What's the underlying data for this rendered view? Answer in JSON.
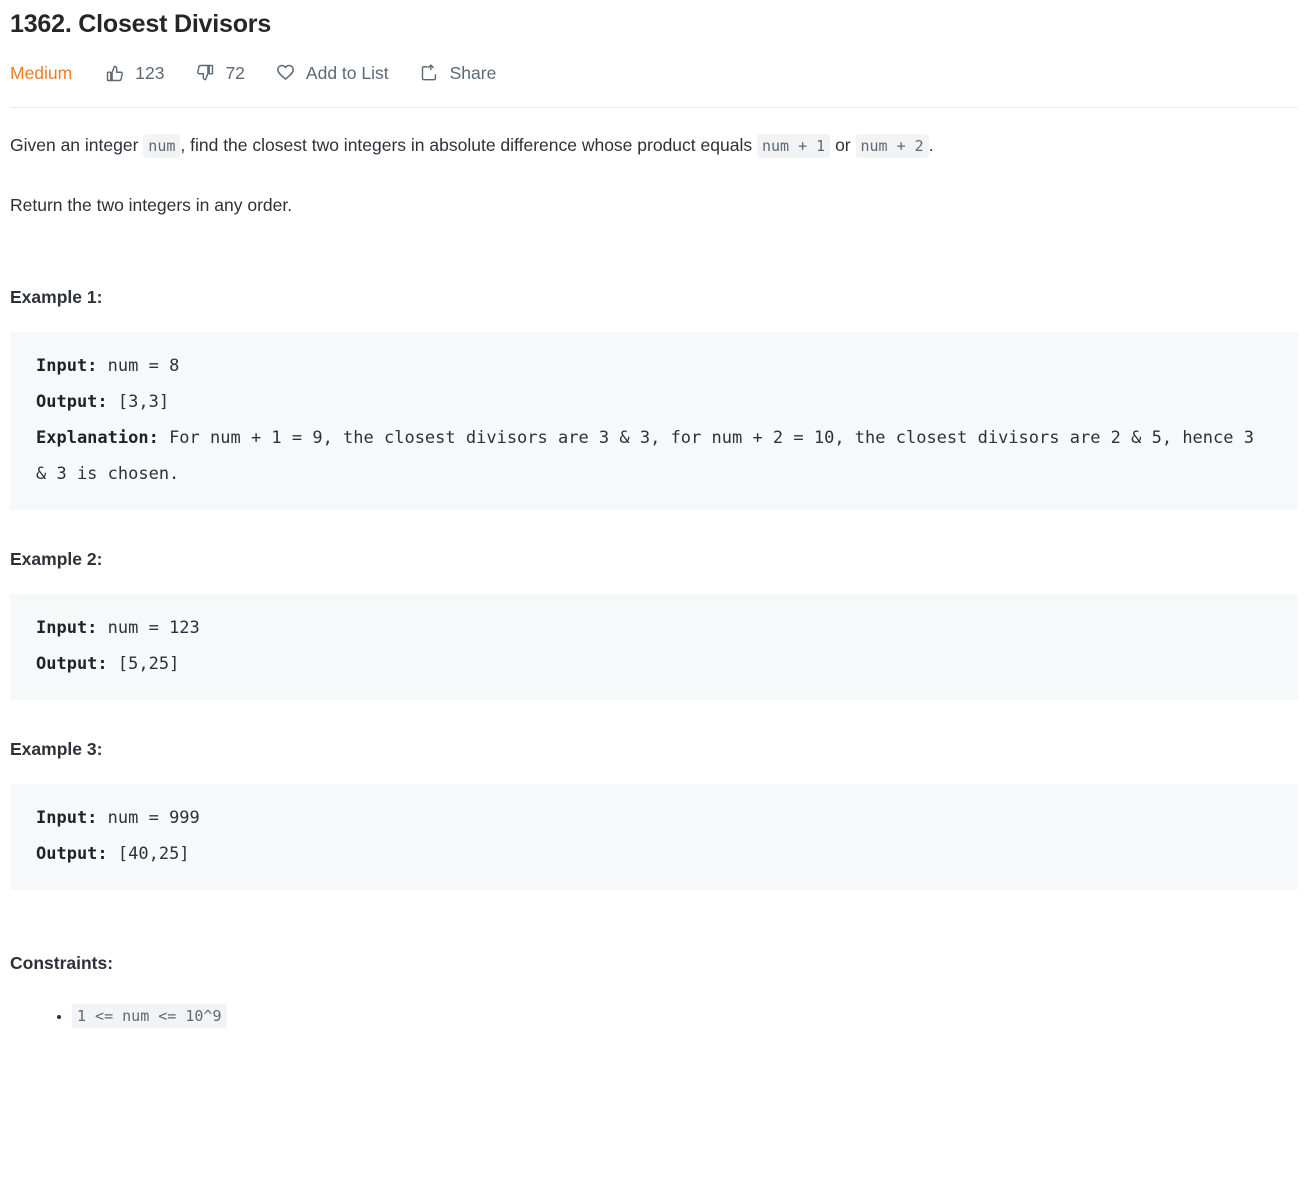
{
  "header": {
    "title": "1362. Closest Divisors",
    "difficulty": "Medium",
    "difficulty_color": "#ef7c22",
    "likes_icon": "thumbs-up-icon",
    "likes": "123",
    "dislikes_icon": "thumbs-down-icon",
    "dislikes": "72",
    "add_to_list_icon": "heart-icon",
    "add_to_list_label": "Add to List",
    "share_icon": "share-icon",
    "share_label": "Share"
  },
  "description": {
    "part1": "Given an integer",
    "code1": "num",
    "part2": ", find the closest two integers in absolute difference whose product equals",
    "code2": "num + 1",
    "part3": "or",
    "code3": "num + 2",
    "part4": ".",
    "return_line": "Return the two integers in any order."
  },
  "examples": [
    {
      "heading": "Example 1:",
      "input_label": "Input:",
      "input_value": " num = 8",
      "output_label": "Output:",
      "output_value": " [3,3]",
      "explanation_label": "Explanation:",
      "explanation_value": " For num + 1 = 9, the closest divisors are 3 & 3, for num + 2 = 10, the closest divisors are 2 & 5, hence 3 & 3 is chosen."
    },
    {
      "heading": "Example 2:",
      "input_label": "Input:",
      "input_value": " num = 123",
      "output_label": "Output:",
      "output_value": " [5,25]",
      "explanation_label": "",
      "explanation_value": ""
    },
    {
      "heading": "Example 3:",
      "input_label": "Input:",
      "input_value": " num = 999",
      "output_label": "Output:",
      "output_value": " [40,25]",
      "explanation_label": "",
      "explanation_value": ""
    }
  ],
  "constraints": {
    "heading": "Constraints:",
    "items": [
      "1 <= num <= 10^9"
    ]
  }
}
